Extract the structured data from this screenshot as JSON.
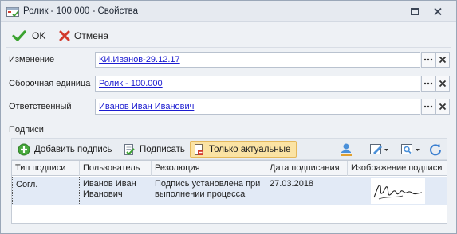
{
  "window": {
    "title": "Ролик - 100.000 - Свойства"
  },
  "toolbar": {
    "ok_label": "OK",
    "cancel_label": "Отмена"
  },
  "fields": [
    {
      "label": "Изменение",
      "value": "КИ.Иванов-29.12.17"
    },
    {
      "label": "Сборочная единица",
      "value": "Ролик - 100.000"
    },
    {
      "label": "Ответственный",
      "value": "Иванов Иван Иванович"
    }
  ],
  "signatures": {
    "section_title": "Подписи",
    "toolbar": {
      "add_label": "Добавить подпись",
      "sign_label": "Подписать",
      "actual_label": "Только актуальные"
    },
    "columns": [
      "Тип подписи",
      "Пользователь",
      "Резолюция",
      "Дата подписания",
      "Изображение подписи"
    ],
    "rows": [
      {
        "type": "Согл.",
        "user_line1": "Иванов Иван",
        "user_line2": "Иванович",
        "resolution_line1": "Подпись установлена при",
        "resolution_line2": "выполнении процесса",
        "date": "27.03.2018"
      }
    ]
  },
  "colors": {
    "accent_link": "#1b1bd0",
    "active_toggle": "#fbe3a4",
    "selected_row": "#e2eaf6"
  }
}
